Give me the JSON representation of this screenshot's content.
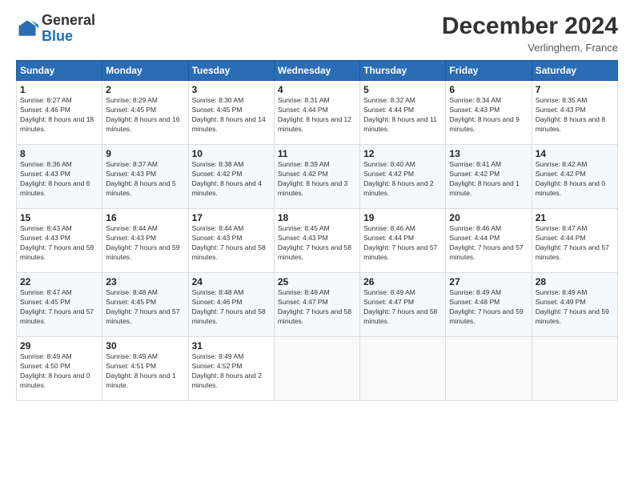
{
  "header": {
    "logo_general": "General",
    "logo_blue": "Blue",
    "month_title": "December 2024",
    "subtitle": "Verlinghem, France"
  },
  "days_of_week": [
    "Sunday",
    "Monday",
    "Tuesday",
    "Wednesday",
    "Thursday",
    "Friday",
    "Saturday"
  ],
  "weeks": [
    [
      {
        "day": "1",
        "info": "Sunrise: 8:27 AM\nSunset: 4:46 PM\nDaylight: 8 hours and 18 minutes."
      },
      {
        "day": "2",
        "info": "Sunrise: 8:29 AM\nSunset: 4:45 PM\nDaylight: 8 hours and 16 minutes."
      },
      {
        "day": "3",
        "info": "Sunrise: 8:30 AM\nSunset: 4:45 PM\nDaylight: 8 hours and 14 minutes."
      },
      {
        "day": "4",
        "info": "Sunrise: 8:31 AM\nSunset: 4:44 PM\nDaylight: 8 hours and 12 minutes."
      },
      {
        "day": "5",
        "info": "Sunrise: 8:32 AM\nSunset: 4:44 PM\nDaylight: 8 hours and 11 minutes."
      },
      {
        "day": "6",
        "info": "Sunrise: 8:34 AM\nSunset: 4:43 PM\nDaylight: 8 hours and 9 minutes."
      },
      {
        "day": "7",
        "info": "Sunrise: 8:35 AM\nSunset: 4:43 PM\nDaylight: 8 hours and 8 minutes."
      }
    ],
    [
      {
        "day": "8",
        "info": "Sunrise: 8:36 AM\nSunset: 4:43 PM\nDaylight: 8 hours and 6 minutes."
      },
      {
        "day": "9",
        "info": "Sunrise: 8:37 AM\nSunset: 4:43 PM\nDaylight: 8 hours and 5 minutes."
      },
      {
        "day": "10",
        "info": "Sunrise: 8:38 AM\nSunset: 4:42 PM\nDaylight: 8 hours and 4 minutes."
      },
      {
        "day": "11",
        "info": "Sunrise: 8:39 AM\nSunset: 4:42 PM\nDaylight: 8 hours and 3 minutes."
      },
      {
        "day": "12",
        "info": "Sunrise: 8:40 AM\nSunset: 4:42 PM\nDaylight: 8 hours and 2 minutes."
      },
      {
        "day": "13",
        "info": "Sunrise: 8:41 AM\nSunset: 4:42 PM\nDaylight: 8 hours and 1 minute."
      },
      {
        "day": "14",
        "info": "Sunrise: 8:42 AM\nSunset: 4:42 PM\nDaylight: 8 hours and 0 minutes."
      }
    ],
    [
      {
        "day": "15",
        "info": "Sunrise: 8:43 AM\nSunset: 4:43 PM\nDaylight: 7 hours and 59 minutes."
      },
      {
        "day": "16",
        "info": "Sunrise: 8:44 AM\nSunset: 4:43 PM\nDaylight: 7 hours and 59 minutes."
      },
      {
        "day": "17",
        "info": "Sunrise: 8:44 AM\nSunset: 4:43 PM\nDaylight: 7 hours and 58 minutes."
      },
      {
        "day": "18",
        "info": "Sunrise: 8:45 AM\nSunset: 4:43 PM\nDaylight: 7 hours and 58 minutes."
      },
      {
        "day": "19",
        "info": "Sunrise: 8:46 AM\nSunset: 4:44 PM\nDaylight: 7 hours and 57 minutes."
      },
      {
        "day": "20",
        "info": "Sunrise: 8:46 AM\nSunset: 4:44 PM\nDaylight: 7 hours and 57 minutes."
      },
      {
        "day": "21",
        "info": "Sunrise: 8:47 AM\nSunset: 4:44 PM\nDaylight: 7 hours and 57 minutes."
      }
    ],
    [
      {
        "day": "22",
        "info": "Sunrise: 8:47 AM\nSunset: 4:45 PM\nDaylight: 7 hours and 57 minutes."
      },
      {
        "day": "23",
        "info": "Sunrise: 8:48 AM\nSunset: 4:45 PM\nDaylight: 7 hours and 57 minutes."
      },
      {
        "day": "24",
        "info": "Sunrise: 8:48 AM\nSunset: 4:46 PM\nDaylight: 7 hours and 58 minutes."
      },
      {
        "day": "25",
        "info": "Sunrise: 8:48 AM\nSunset: 4:47 PM\nDaylight: 7 hours and 58 minutes."
      },
      {
        "day": "26",
        "info": "Sunrise: 8:49 AM\nSunset: 4:47 PM\nDaylight: 7 hours and 58 minutes."
      },
      {
        "day": "27",
        "info": "Sunrise: 8:49 AM\nSunset: 4:48 PM\nDaylight: 7 hours and 59 minutes."
      },
      {
        "day": "28",
        "info": "Sunrise: 8:49 AM\nSunset: 4:49 PM\nDaylight: 7 hours and 59 minutes."
      }
    ],
    [
      {
        "day": "29",
        "info": "Sunrise: 8:49 AM\nSunset: 4:50 PM\nDaylight: 8 hours and 0 minutes."
      },
      {
        "day": "30",
        "info": "Sunrise: 8:49 AM\nSunset: 4:51 PM\nDaylight: 8 hours and 1 minute."
      },
      {
        "day": "31",
        "info": "Sunrise: 8:49 AM\nSunset: 4:52 PM\nDaylight: 8 hours and 2 minutes."
      },
      {
        "day": "",
        "info": ""
      },
      {
        "day": "",
        "info": ""
      },
      {
        "day": "",
        "info": ""
      },
      {
        "day": "",
        "info": ""
      }
    ]
  ]
}
